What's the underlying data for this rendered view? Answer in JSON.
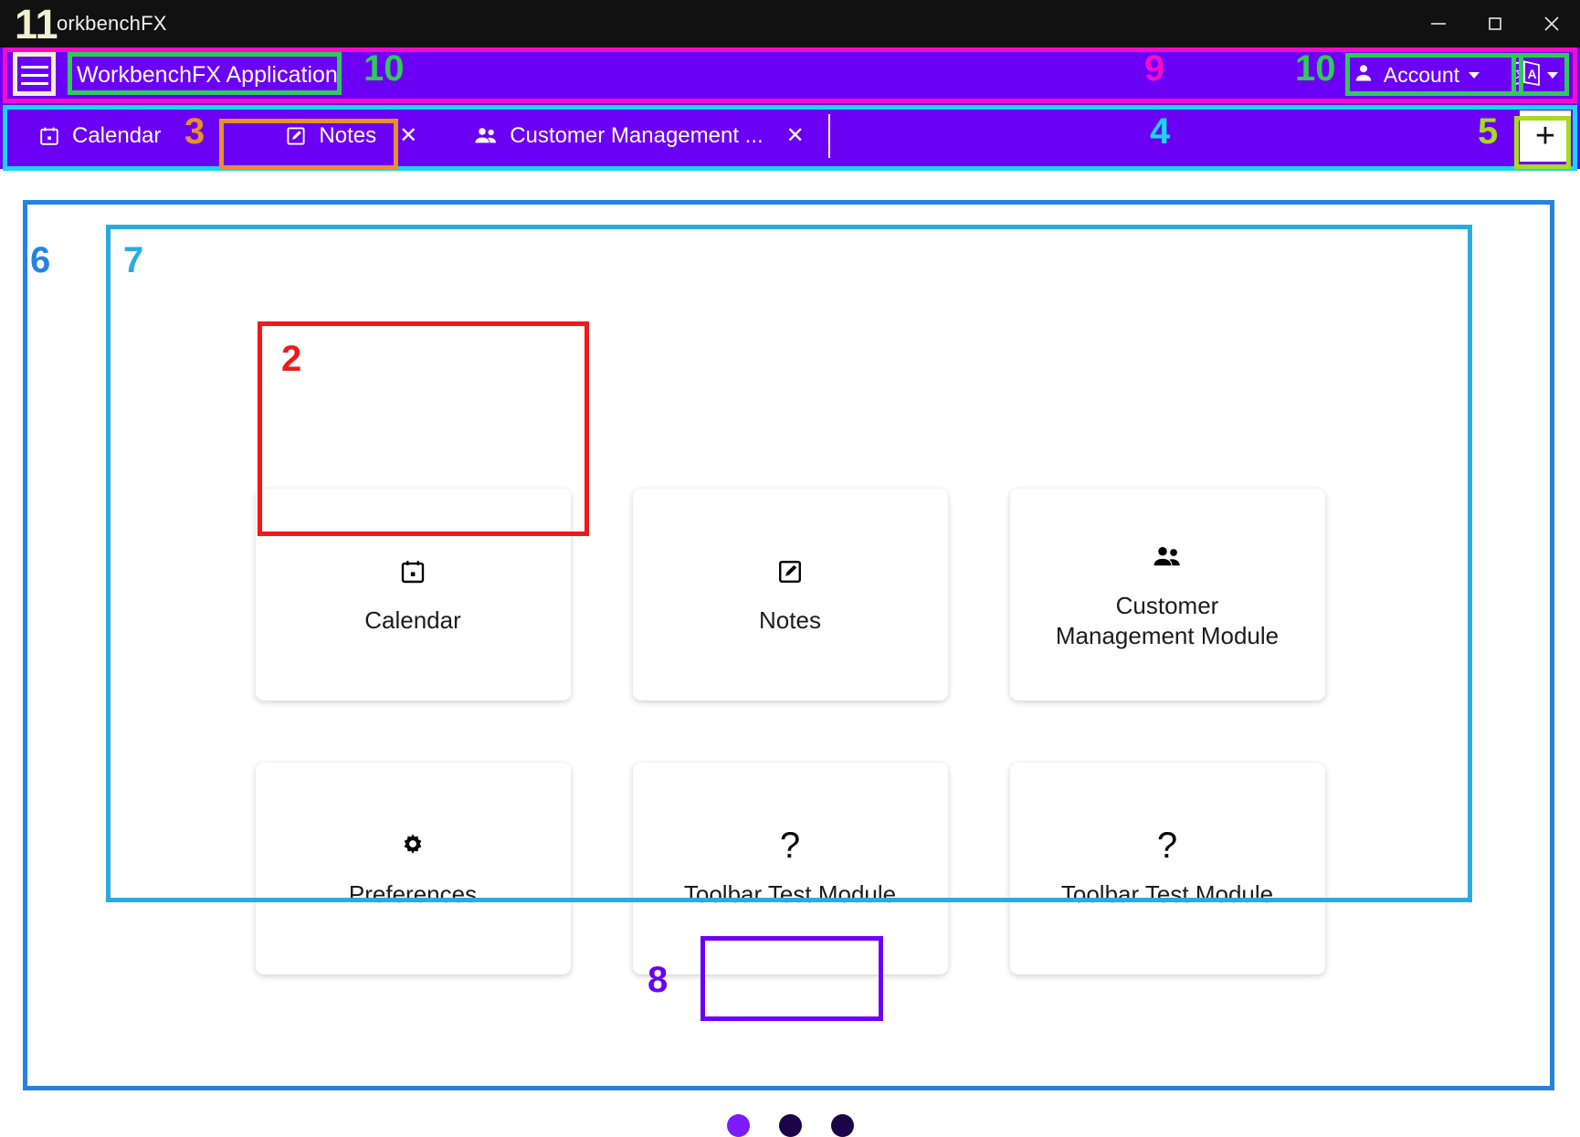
{
  "window": {
    "os_title": "orkbenchFX",
    "controls": {
      "minimize": "minimize-icon",
      "maximize": "maximize-icon",
      "close": "close-icon"
    }
  },
  "toolbar": {
    "menu_icon": "hamburger-menu-icon",
    "app_title": "WorkbenchFX Application",
    "account_label": "Account",
    "account_icon": "person-icon",
    "language_icon": "translate-icon"
  },
  "tabs": {
    "items": [
      {
        "label": "Calendar",
        "icon": "calendar-icon",
        "closable": false,
        "close_label": ""
      },
      {
        "label": "Notes",
        "icon": "note-edit-icon",
        "closable": true,
        "close_label": "✕"
      },
      {
        "label": "Customer Management ...",
        "icon": "people-icon",
        "closable": true,
        "close_label": "✕"
      }
    ],
    "add_tab_label": "+"
  },
  "home": {
    "tiles": [
      {
        "label": "Calendar",
        "icon": "calendar-icon"
      },
      {
        "label": "Notes",
        "icon": "note-edit-icon"
      },
      {
        "label": "Customer Management Module",
        "icon": "people-icon"
      },
      {
        "label": "Preferences",
        "icon": "gear-icon"
      },
      {
        "label": "Toolbar Test Module",
        "icon": "question-mark-icon"
      },
      {
        "label": "Toolbar Test Module",
        "icon": "question-mark-icon"
      }
    ],
    "pagination": {
      "count": 3,
      "active_index": 0
    }
  },
  "annotations": [
    {
      "id": "11",
      "label": "11",
      "color": "#F2EFD0"
    },
    {
      "id": "10a",
      "label": "10",
      "color": "#2ECC55"
    },
    {
      "id": "9",
      "label": "9",
      "color": "#F50CC8"
    },
    {
      "id": "10b",
      "label": "10",
      "color": "#2ECC55"
    },
    {
      "id": "3",
      "label": "3",
      "color": "#E8902A"
    },
    {
      "id": "4",
      "label": "4",
      "color": "#18D7F2"
    },
    {
      "id": "5",
      "label": "5",
      "color": "#A6DB21"
    },
    {
      "id": "6",
      "label": "6",
      "color": "#2583DF"
    },
    {
      "id": "7",
      "label": "7",
      "color": "#29ABE2"
    },
    {
      "id": "2",
      "label": "2",
      "color": "#EE1A1A"
    },
    {
      "id": "8",
      "label": "8",
      "color": "#6B00F5"
    }
  ],
  "colors": {
    "toolbar_purple": "#6B00F5",
    "titlebar_black": "#111111",
    "accent_magenta": "#F50CC8",
    "accent_cyan": "#18D7F2",
    "accent_green": "#2ECC55",
    "accent_orange": "#E8902A",
    "accent_red": "#EE1A1A",
    "accent_lime": "#A6DB21",
    "accent_blue": "#2583DF",
    "accent_lightblue": "#29ABE2",
    "dot_active": "#7B1BFF",
    "dot_inactive": "#1d0347"
  }
}
